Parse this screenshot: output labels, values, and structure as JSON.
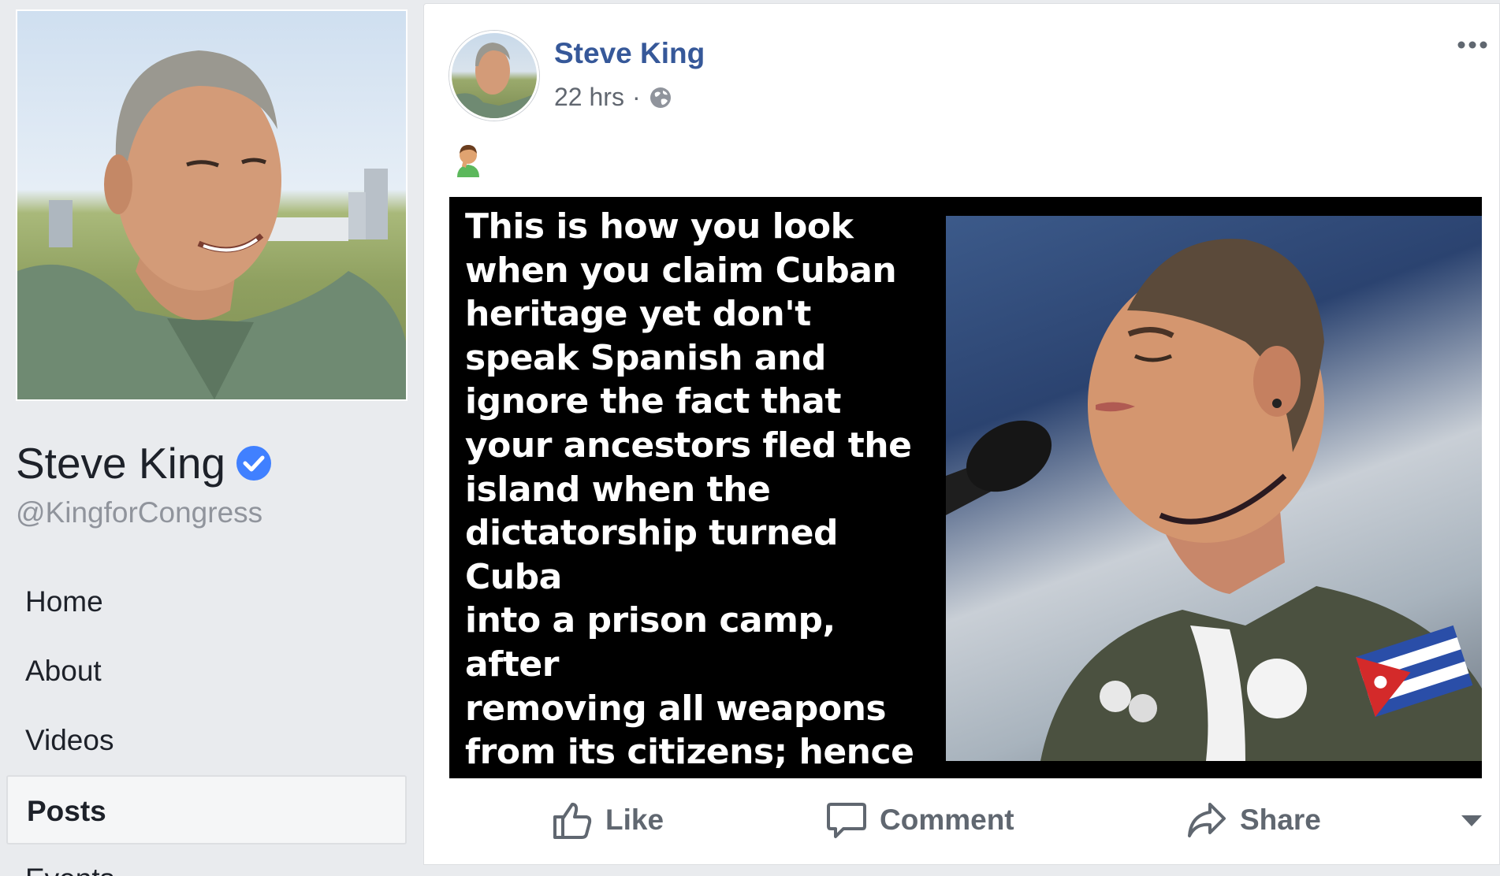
{
  "sidebar": {
    "page_name": "Steve King",
    "handle": "@KingforCongress",
    "nav": [
      {
        "label": "Home"
      },
      {
        "label": "About"
      },
      {
        "label": "Videos"
      },
      {
        "label": "Posts"
      },
      {
        "label": "Events"
      }
    ]
  },
  "post": {
    "author": "Steve King",
    "time": "22 hrs",
    "separator": "·",
    "privacy_icon": "globe-icon",
    "emoji": "facepalm-icon",
    "image_text": "This is how you look\nwhen you claim Cuban\nheritage yet don't\nspeak Spanish and\nignore the fact that\nyour ancestors fled the\nisland when the\ndictatorship turned Cuba\n into  a prison camp, after\nremoving all weapons\nfrom its citizens; hence\ntheir right to self\ndefense.",
    "actions": {
      "like": "Like",
      "comment": "Comment",
      "share": "Share"
    }
  },
  "colors": {
    "link_blue": "#365899",
    "verified_blue": "#4080ff",
    "page_bg": "#e9ebee"
  }
}
